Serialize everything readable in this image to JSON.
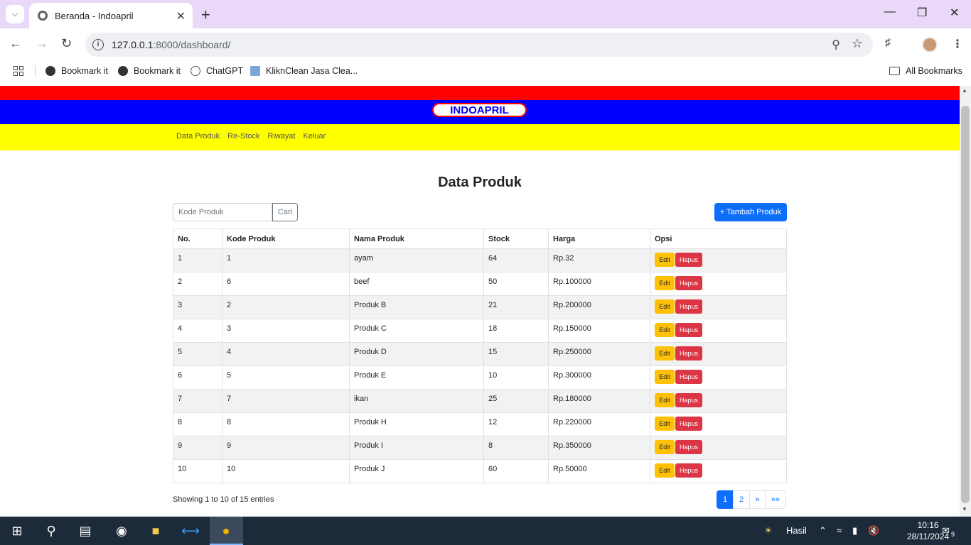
{
  "browser": {
    "tab_title": "Beranda - Indoapril",
    "url_host": "127.0.0.1",
    "url_rest": ":8000/dashboard/",
    "bookmarks": [
      "Bookmark it",
      "Bookmark it",
      "ChatGPT",
      "KliknClean Jasa Clea..."
    ],
    "all_bookmarks": "All Bookmarks"
  },
  "site": {
    "brand": "INDOAPRIL",
    "nav": [
      "Data Produk",
      "Re-Stock",
      "Riwayat",
      "Keluar"
    ]
  },
  "main": {
    "title": "Data Produk",
    "search_placeholder": "Kode Produk",
    "search_button": "Cari",
    "add_button": "+ Tambah Produk",
    "columns": [
      "No.",
      "Kode Produk",
      "Nama Produk",
      "Stock",
      "Harga",
      "Opsi"
    ],
    "rows": [
      [
        "1",
        "1",
        "ayam",
        "64",
        "Rp.32"
      ],
      [
        "2",
        "6",
        "beef",
        "50",
        "Rp.100000"
      ],
      [
        "3",
        "2",
        "Produk B",
        "21",
        "Rp.200000"
      ],
      [
        "4",
        "3",
        "Produk C",
        "18",
        "Rp.150000"
      ],
      [
        "5",
        "4",
        "Produk D",
        "15",
        "Rp.250000"
      ],
      [
        "6",
        "5",
        "Produk E",
        "10",
        "Rp.300000"
      ],
      [
        "7",
        "7",
        "ikan",
        "25",
        "Rp.180000"
      ],
      [
        "8",
        "8",
        "Produk H",
        "12",
        "Rp.220000"
      ],
      [
        "9",
        "9",
        "Produk I",
        "8",
        "Rp.350000"
      ],
      [
        "10",
        "10",
        "Produk J",
        "60",
        "Rp.50000"
      ]
    ],
    "edit_label": "Edit",
    "delete_label": "Hapus",
    "entries_text": "Showing 1 to 10 of 15 entries",
    "pages": [
      "1",
      "2",
      "»",
      "»»"
    ]
  },
  "taskbar": {
    "weather": "Hasil",
    "time": "10:16",
    "date": "28/11/2024",
    "notifications": "9"
  },
  "colors": {
    "band_red": "#ff0000",
    "band_blue": "#0000ff",
    "band_yellow": "#ffff00",
    "primary": "#0d6efd",
    "warning": "#ffc107",
    "danger": "#dc3545"
  }
}
